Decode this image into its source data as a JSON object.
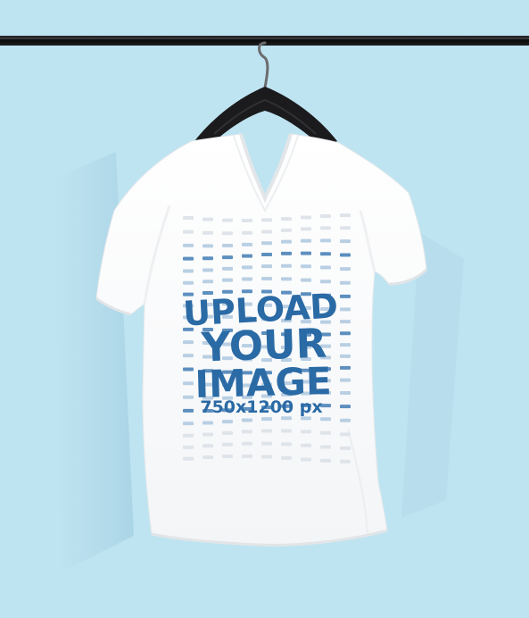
{
  "mockup": {
    "headline_line1": "UPLOAD",
    "headline_line2": "YOUR",
    "headline_line3": "IMAGE",
    "dimensions": "750x1200 px"
  },
  "colors": {
    "background": "#bfe4f1",
    "shirt": "#ffffff",
    "print_text": "#2a6aa5",
    "dash_light": "#dfe4ea",
    "dash_mid": "#b9cfe3",
    "dash_dark": "#5d8fbf",
    "hanger": "#1b1b1d",
    "rail": "#0f0f10"
  },
  "icons": [
    "hanger-icon",
    "clothing-rail-icon"
  ]
}
